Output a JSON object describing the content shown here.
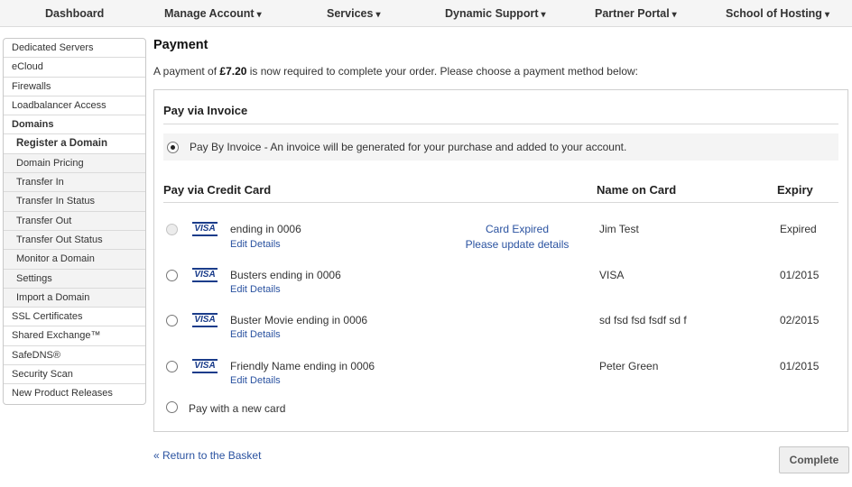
{
  "nav": {
    "dashboard": "Dashboard",
    "manage_account": "Manage Account",
    "services": "Services",
    "dynamic_support": "Dynamic Support",
    "partner_portal": "Partner Portal",
    "school_of_hosting": "School of Hosting",
    "caret": "▾"
  },
  "sidebar": {
    "items": [
      "Dedicated Servers",
      "eCloud",
      "Firewalls",
      "Loadbalancer Access",
      "Domains",
      "Register a Domain",
      "Domain Pricing",
      "Transfer In",
      "Transfer In Status",
      "Transfer Out",
      "Transfer Out Status",
      "Monitor a Domain",
      "Settings",
      "Import a Domain",
      "SSL Certificates",
      "Shared Exchange™",
      "SafeDNS®",
      "Security Scan",
      "New Product Releases"
    ]
  },
  "page": {
    "title": "Payment",
    "intro_prefix": "A payment of ",
    "amount": "£7.20",
    "intro_suffix": " is now required to complete your order. Please choose a payment method below:"
  },
  "invoice": {
    "heading": "Pay via Invoice",
    "option": "Pay By Invoice - An invoice will be generated for your purchase and added to your account.",
    "selected": true
  },
  "cards": {
    "heading": "Pay via Credit Card",
    "col_name": "Name on Card",
    "col_expiry": "Expiry",
    "card_brand": "VISA",
    "edit_label": "Edit Details",
    "rows": [
      {
        "label": "ending in 0006",
        "status_line1": "Card Expired",
        "status_line2": "Please update details",
        "name": "Jim Test",
        "expiry": "Expired",
        "disabled": true
      },
      {
        "label": "Busters ending in 0006",
        "name": "VISA",
        "expiry": "01/2015",
        "disabled": false
      },
      {
        "label": "Buster Movie ending in 0006",
        "name": "sd fsd fsd fsdf sd f",
        "expiry": "02/2015",
        "disabled": false
      },
      {
        "label": "Friendly Name ending in 0006",
        "name": "Peter Green",
        "expiry": "01/2015",
        "disabled": false
      }
    ],
    "new_card": "Pay with a new card"
  },
  "footer": {
    "back_link": "« Return to the Basket",
    "complete": "Complete"
  },
  "colors": {
    "link": "#2a52a0",
    "visa_blue": "#1a3c8a"
  }
}
